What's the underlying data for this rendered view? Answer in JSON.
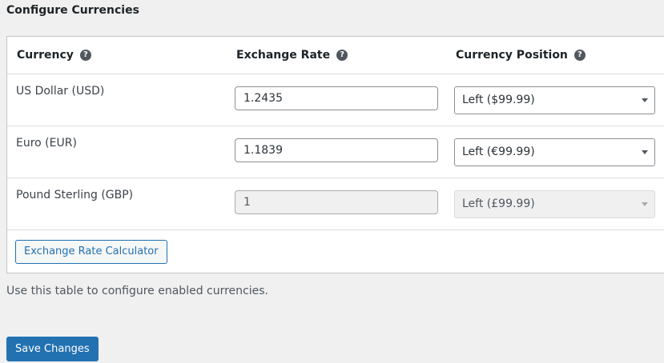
{
  "section": {
    "title": "Configure Currencies"
  },
  "table": {
    "headers": {
      "currency": "Currency",
      "exchange_rate": "Exchange Rate",
      "currency_position": "Currency Position"
    },
    "help_icon": "question-circle-icon",
    "rows": [
      {
        "name": "US Dollar (USD)",
        "rate": "1.2435",
        "position": "Left ($99.99)",
        "disabled": false
      },
      {
        "name": "Euro (EUR)",
        "rate": "1.1839",
        "position": "Left (€99.99)",
        "disabled": false
      },
      {
        "name": "Pound Sterling (GBP)",
        "rate": "1",
        "position": "Left (£99.99)",
        "disabled": true
      }
    ],
    "calculator_button": "Exchange Rate Calculator"
  },
  "description": "Use this table to configure enabled currencies.",
  "save_button": "Save Changes",
  "colors": {
    "accent": "#2271b1",
    "background": "#f0f0f1"
  }
}
